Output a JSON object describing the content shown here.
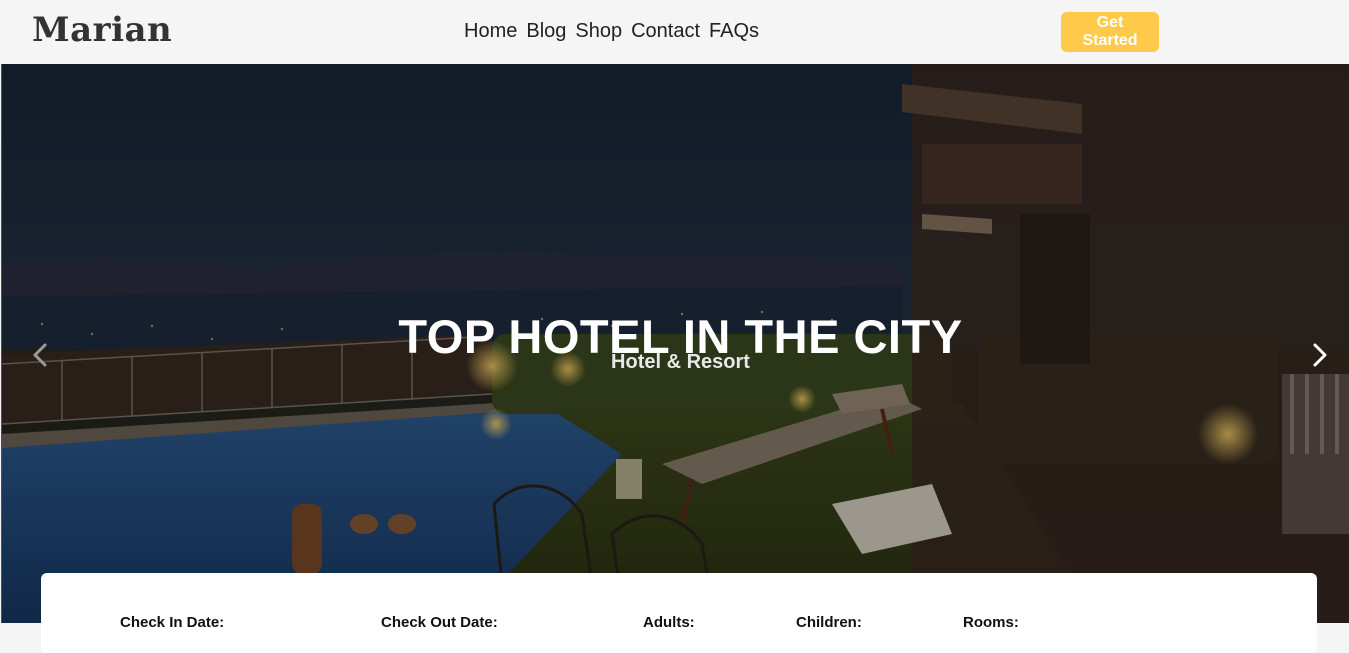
{
  "header": {
    "logo": "Marian",
    "nav": [
      "Home",
      "Blog",
      "Shop",
      "Contact",
      "FAQs"
    ],
    "cta_label": "Get Started"
  },
  "hero": {
    "title": "TOP HOTEL IN THE CITY",
    "subtitle": "Hotel & Resort",
    "prev_icon": "chevron-left-icon",
    "next_icon": "chevron-right-icon"
  },
  "booking": {
    "check_in_label": "Check In Date:",
    "check_out_label": "Check Out Date:",
    "adults_label": "Adults:",
    "children_label": "Children:",
    "rooms_label": "Rooms:"
  },
  "colors": {
    "accent": "#ffc94a",
    "header_bg": "#f5f5f5",
    "text_dark": "#222222"
  }
}
